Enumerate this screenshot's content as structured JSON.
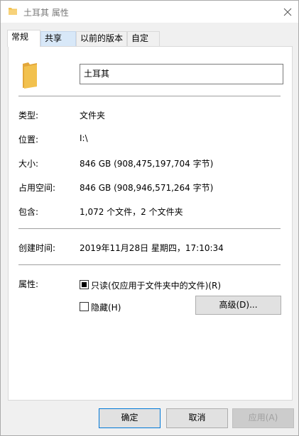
{
  "window": {
    "title": "土耳其 属性"
  },
  "tabs": [
    {
      "label": "常规"
    },
    {
      "label": "共享"
    },
    {
      "label": "以前的版本"
    },
    {
      "label": "自定义"
    }
  ],
  "general": {
    "name_value": "土耳其",
    "rows": [
      {
        "label": "类型:",
        "value": "文件夹"
      },
      {
        "label": "位置:",
        "value": "I:\\"
      },
      {
        "label": "大小:",
        "value": "846 GB (908,475,197,704 字节)"
      },
      {
        "label": "占用空间:",
        "value": "846 GB (908,946,571,264 字节)"
      },
      {
        "label": "包含:",
        "value": "1,072 个文件，2 个文件夹"
      }
    ],
    "created": {
      "label": "创建时间:",
      "value": "2019年11月28日 星期四，17:10:34"
    },
    "attributes": {
      "label": "属性:",
      "readonly_label": "只读(仅应用于文件夹中的文件)(R)",
      "readonly_state": "indeterminate",
      "hidden_label": "隐藏(H)",
      "hidden_state": "unchecked",
      "advanced_label": "高级(D)..."
    }
  },
  "footer": {
    "ok_label": "确定",
    "cancel_label": "取消",
    "apply_label": "应用(A)"
  },
  "colors": {
    "folder": "#f2c14e",
    "folder_dark": "#e3a73a",
    "accent": "#0078d7"
  }
}
